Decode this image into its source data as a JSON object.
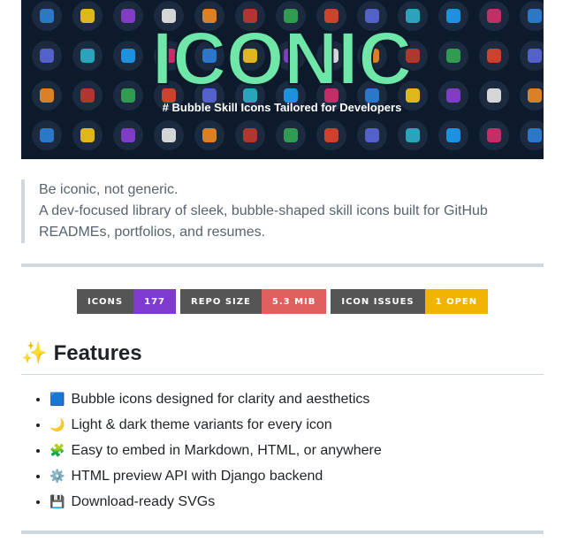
{
  "banner": {
    "title": "ICONIC",
    "tagline": "# Bubble Skill Icons Tailored for Developers",
    "colors": {
      "bg": "#0d1a2b",
      "title": "#6ee7a8",
      "tagline": "#ffffff"
    }
  },
  "quote": {
    "line1": "Be iconic, not generic.",
    "line2": "A dev-focused library of sleek, bubble-shaped skill icons built for GitHub READMEs, portfolios, and resumes."
  },
  "badges": [
    {
      "label": "ICONS",
      "value": "177",
      "color": "#7e3ccf"
    },
    {
      "label": "REPO SIZE",
      "value": "5.3 MIB",
      "color": "#e0605e"
    },
    {
      "label": "ICON ISSUES",
      "value": "1 OPEN",
      "color": "#f0b400"
    }
  ],
  "features": {
    "heading_icon": "✨",
    "heading": "Features",
    "items": [
      {
        "icon": "🟦",
        "text": "Bubble icons designed for clarity and aesthetics"
      },
      {
        "icon": "🌙",
        "text": "Light & dark theme variants for every icon"
      },
      {
        "icon": "🧩",
        "text": "Easy to embed in Markdown, HTML, or anywhere"
      },
      {
        "icon": "⚙️",
        "text": "HTML preview API with Django backend"
      },
      {
        "icon": "💾",
        "text": "Download-ready SVGs"
      }
    ]
  }
}
